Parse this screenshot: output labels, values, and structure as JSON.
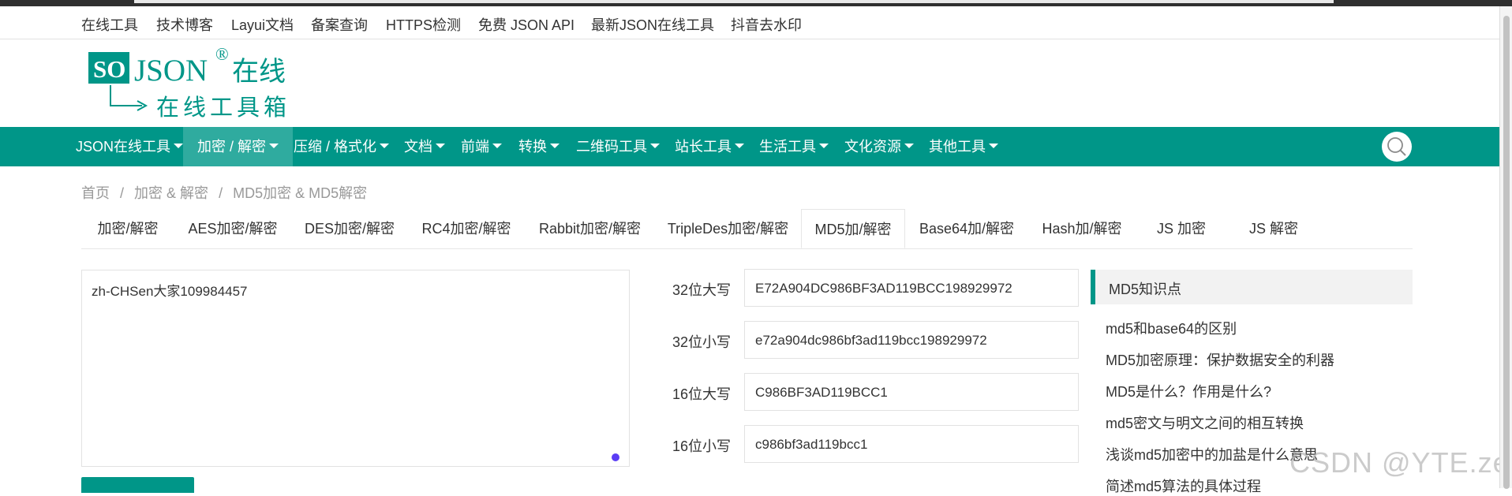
{
  "top_links": [
    "在线工具",
    "技术博客",
    "Layui文档",
    "备案查询",
    "HTTPS检测",
    "免费 JSON API",
    "最新JSON在线工具",
    "抖音去水印"
  ],
  "logo": {
    "badge": "SO",
    "name": "JSON",
    "reg": "®",
    "cn": "在线",
    "slogan": "在线工具箱",
    "colors": {
      "brand": "#009688"
    }
  },
  "nav": {
    "items": [
      "JSON在线工具",
      "加密 / 解密",
      "压缩 / 格式化",
      "文档",
      "前端",
      "转换",
      "二维码工具",
      "站长工具",
      "生活工具",
      "文化资源",
      "其他工具"
    ],
    "active_index": 1,
    "search_icon": "search-icon"
  },
  "breadcrumb": [
    "首页",
    "/",
    "加密 & 解密",
    "/",
    "MD5加密 & MD5解密"
  ],
  "tabs": [
    "加密/解密",
    "AES加密/解密",
    "DES加密/解密",
    "RC4加密/解密",
    "Rabbit加密/解密",
    "TripleDes加密/解密",
    "MD5加/解密",
    "Base64加/解密",
    "Hash加/解密",
    "JS 加密",
    "JS 解密"
  ],
  "active_tab": "MD5加/解密",
  "input": {
    "value": "zh-CHSen大家109984457"
  },
  "results": [
    {
      "label": "32位大写",
      "value": "E72A904DC986BF3AD119BCC198929972"
    },
    {
      "label": "32位小写",
      "value": "e72a904dc986bf3ad119bcc198929972"
    },
    {
      "label": "16位大写",
      "value": "C986BF3AD119BCC1"
    },
    {
      "label": "16位小写",
      "value": "c986bf3ad119bcc1"
    }
  ],
  "sidebar": {
    "title": "MD5知识点",
    "links": [
      "md5和base64的区别",
      "MD5加密原理：保护数据安全的利器",
      "MD5是什么？作用是什么?",
      "md5密文与明文之间的相互转换",
      "浅谈md5加密中的加盐是什么意思",
      "简述md5算法的具体过程"
    ]
  },
  "watermark": "CSDN @YTE.zero",
  "colors": {
    "brand": "#009688",
    "active_nav": "#2fab9f"
  }
}
